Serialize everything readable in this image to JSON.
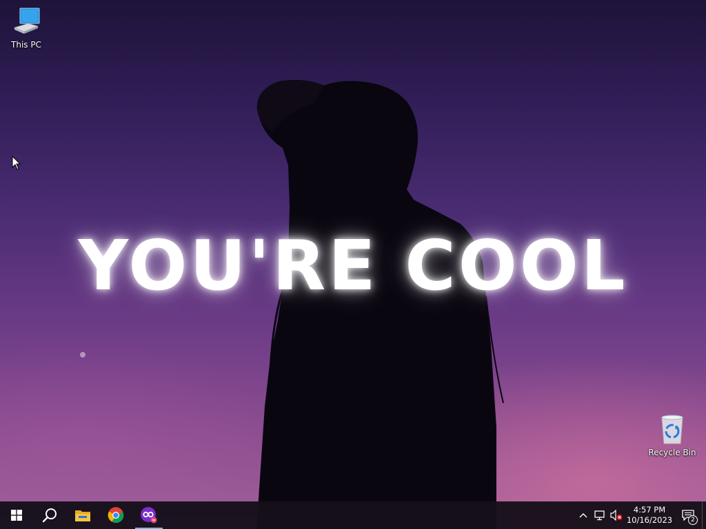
{
  "wallpaper": {
    "text": "YOU'RE COOL"
  },
  "desktop_icons": [
    {
      "label": "This PC",
      "icon": "this-pc-icon"
    },
    {
      "label": "Recycle Bin",
      "icon": "recycle-bin-icon"
    }
  ],
  "taskbar": {
    "start_icon": "windows-logo-icon",
    "search_icon": "search-icon",
    "apps": [
      {
        "name": "File Explorer",
        "icon": "folder-icon",
        "active": false
      },
      {
        "name": "Google Chrome",
        "icon": "chrome-icon",
        "active": false
      },
      {
        "name": "App",
        "icon": "infinity-app-icon",
        "active": true
      }
    ],
    "tray": {
      "chevron_icon": "chevron-up-icon",
      "network_icon": "network-disconnected-icon",
      "volume_icon": "volume-muted-icon",
      "time": "4:57 PM",
      "date": "10/16/2023",
      "notification_count": "2"
    }
  },
  "colors": {
    "taskbar_bg": "#16101a",
    "active_indicator": "#76b9ed",
    "sky_top": "#1e1339",
    "sky_bottom": "#a0609a"
  }
}
